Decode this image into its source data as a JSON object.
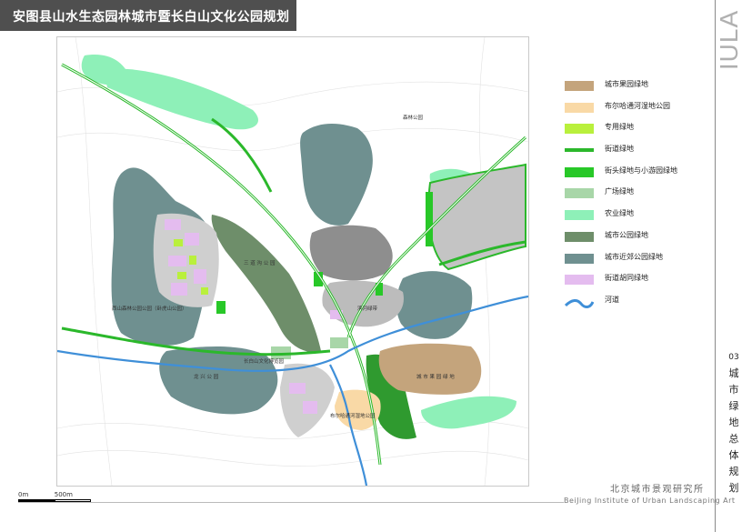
{
  "title": "安图县山水生态园林城市暨长白山文化公园规划",
  "logo_text": "IULA",
  "vertical_title": {
    "number": "03",
    "chars": [
      "城",
      "市",
      "绿",
      "地",
      "总",
      "体",
      "规",
      "划"
    ]
  },
  "institute": {
    "cn": "北京城市景观研究所",
    "en": "BeiJing Institute of Urban Landscaping Art"
  },
  "scale": {
    "zero": "0m",
    "end": "500m"
  },
  "legend": [
    {
      "label": "城市果园绿地",
      "color": "#c4a47c",
      "kind": "fill"
    },
    {
      "label": "布尔哈通河湿地公园",
      "color": "#f9d9a6",
      "kind": "fill"
    },
    {
      "label": "专用绿地",
      "color": "#b9f03c",
      "kind": "fill"
    },
    {
      "label": "街道绿地",
      "color": "#2bb82b",
      "kind": "line"
    },
    {
      "label": "街头绿地与小游园绿地",
      "color": "#28c828",
      "kind": "fill"
    },
    {
      "label": "广场绿地",
      "color": "#a8d6a8",
      "kind": "fill"
    },
    {
      "label": "农业绿地",
      "color": "#8ef0b8",
      "kind": "fill"
    },
    {
      "label": "城市公园绿地",
      "color": "#6e8e6a",
      "kind": "fill"
    },
    {
      "label": "城市近郊公园绿地",
      "color": "#6f9090",
      "kind": "fill"
    },
    {
      "label": "街道胡同绿地",
      "color": "#e4bcef",
      "kind": "fill"
    },
    {
      "label": "河道",
      "color": "#3f8fd8",
      "kind": "river"
    }
  ],
  "map_labels": {
    "west_forest": "西山森林公园公园（卧虎山公园）",
    "west_park": "龙  兴  公  园",
    "changbai_park": "长白山文化博览园",
    "south_park": "布尔哈通河湿地公园",
    "orchard": "城 市 果 园 绿 地",
    "east_park": "城市果园绿地",
    "river_park": "湿地公园",
    "riverside": "滨河绿带",
    "center_square": "广场",
    "city_park": "三 道 沟 公 园",
    "north_label": "森林公园"
  }
}
